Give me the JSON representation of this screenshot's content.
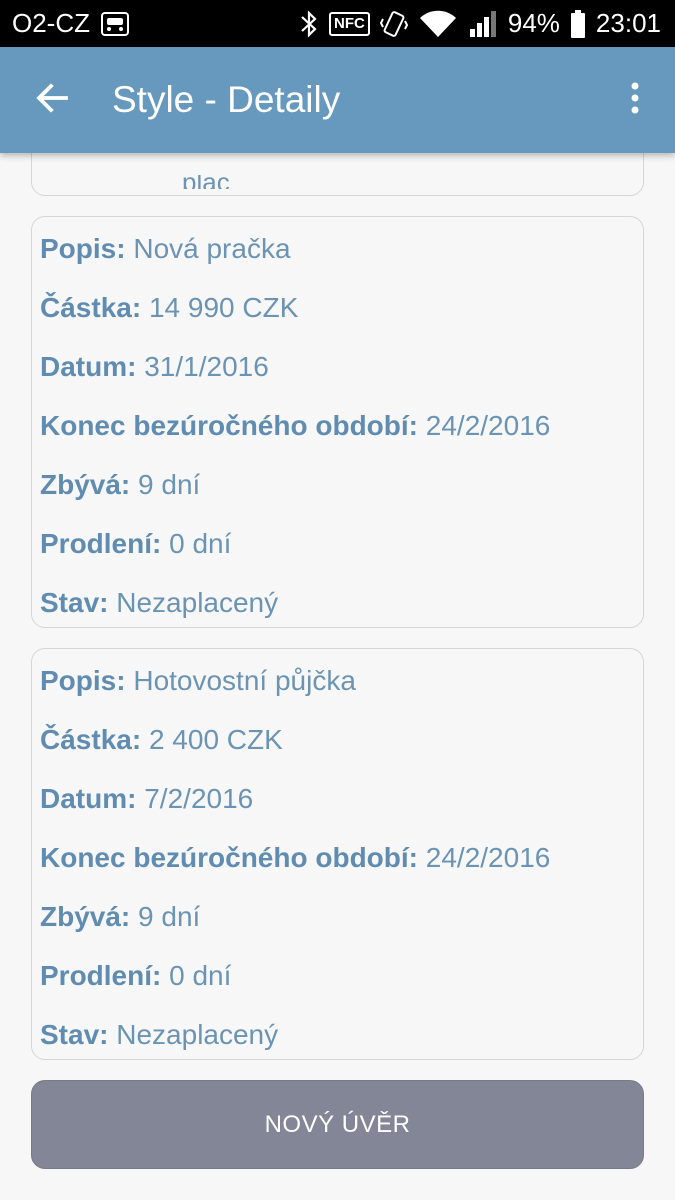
{
  "status_bar": {
    "carrier": "O2-CZ",
    "nfc": "NFC",
    "battery": "94%",
    "time": "23:01"
  },
  "app_bar": {
    "title": "Style - Detaily",
    "back_icon": "arrow-left-icon",
    "menu_icon": "more-vert-icon"
  },
  "clipped_card_text": "plac",
  "cards": [
    {
      "rows": [
        {
          "label": "Popis:",
          "value": "Nová pračka"
        },
        {
          "label": "Částka:",
          "value": "14 990 CZK"
        },
        {
          "label": "Datum:",
          "value": "31/1/2016"
        },
        {
          "label": "Konec bezúročného období:",
          "value": "24/2/2016"
        },
        {
          "label": "Zbývá:",
          "value": "9 dní"
        },
        {
          "label": "Prodlení:",
          "value": "0 dní"
        },
        {
          "label": "Stav:",
          "value": "Nezaplacený"
        }
      ]
    },
    {
      "rows": [
        {
          "label": "Popis:",
          "value": "Hotovostní půjčka"
        },
        {
          "label": "Částka:",
          "value": "2 400 CZK"
        },
        {
          "label": "Datum:",
          "value": "7/2/2016"
        },
        {
          "label": "Konec bezúročného období:",
          "value": "24/2/2016"
        },
        {
          "label": "Zbývá:",
          "value": "9 dní"
        },
        {
          "label": "Prodlení:",
          "value": "0 dní"
        },
        {
          "label": "Stav:",
          "value": "Nezaplacený"
        }
      ]
    }
  ],
  "new_loan_button": "NOVÝ ÚVĚR",
  "colors": {
    "app_bar": "#6699bd",
    "text": "#6b93b3",
    "button": "#838696"
  }
}
